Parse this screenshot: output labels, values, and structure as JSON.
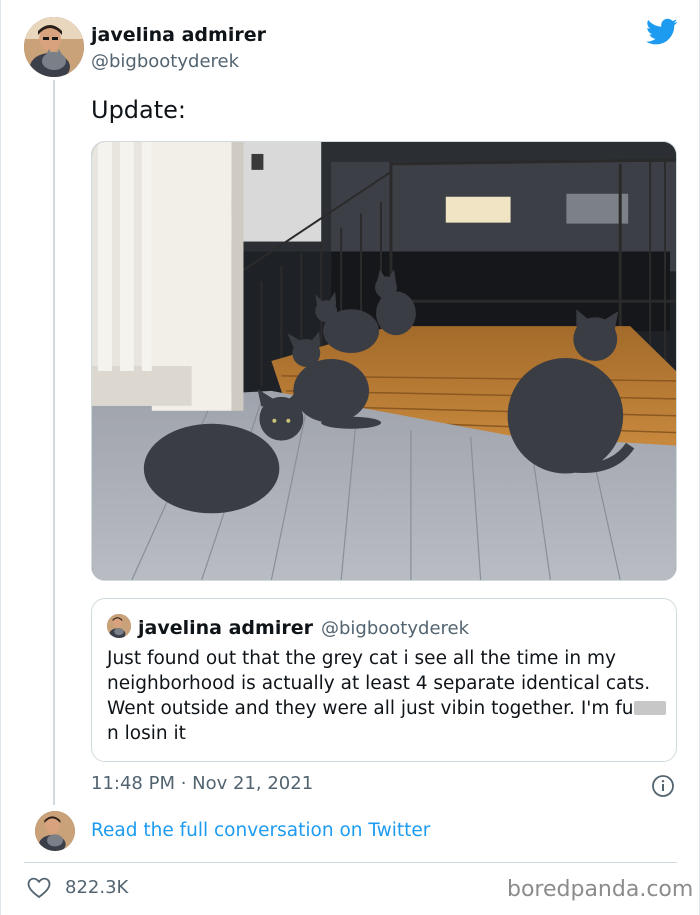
{
  "author": {
    "display_name": "javelina admirer",
    "handle": "@bigbootyderek"
  },
  "tweet": {
    "text": "Update:",
    "photo_alt": "photo-of-grey-cats-on-porch",
    "timestamp": "11:48 PM · Nov 21, 2021"
  },
  "quoted_tweet": {
    "display_name": "javelina admirer",
    "handle": "@bigbootyderek",
    "text_before_censor": "Just found out that the grey cat i see all the time in my neighborhood is actually at least 4 separate identical cats. Went outside and they were all just vibin together. I'm fu",
    "text_after_censor": "n losin it"
  },
  "reply_link": "Read the full conversation on Twitter",
  "stats": {
    "likes": "822.3K"
  },
  "watermark": "boredpanda.com",
  "icons": {
    "brand": "twitter-bird-icon",
    "info": "info-icon",
    "like": "heart-icon"
  },
  "colors": {
    "twitter_blue": "#1d9bf0",
    "text_primary": "#0f1419",
    "text_secondary": "#536471",
    "border": "#cfd9de"
  }
}
